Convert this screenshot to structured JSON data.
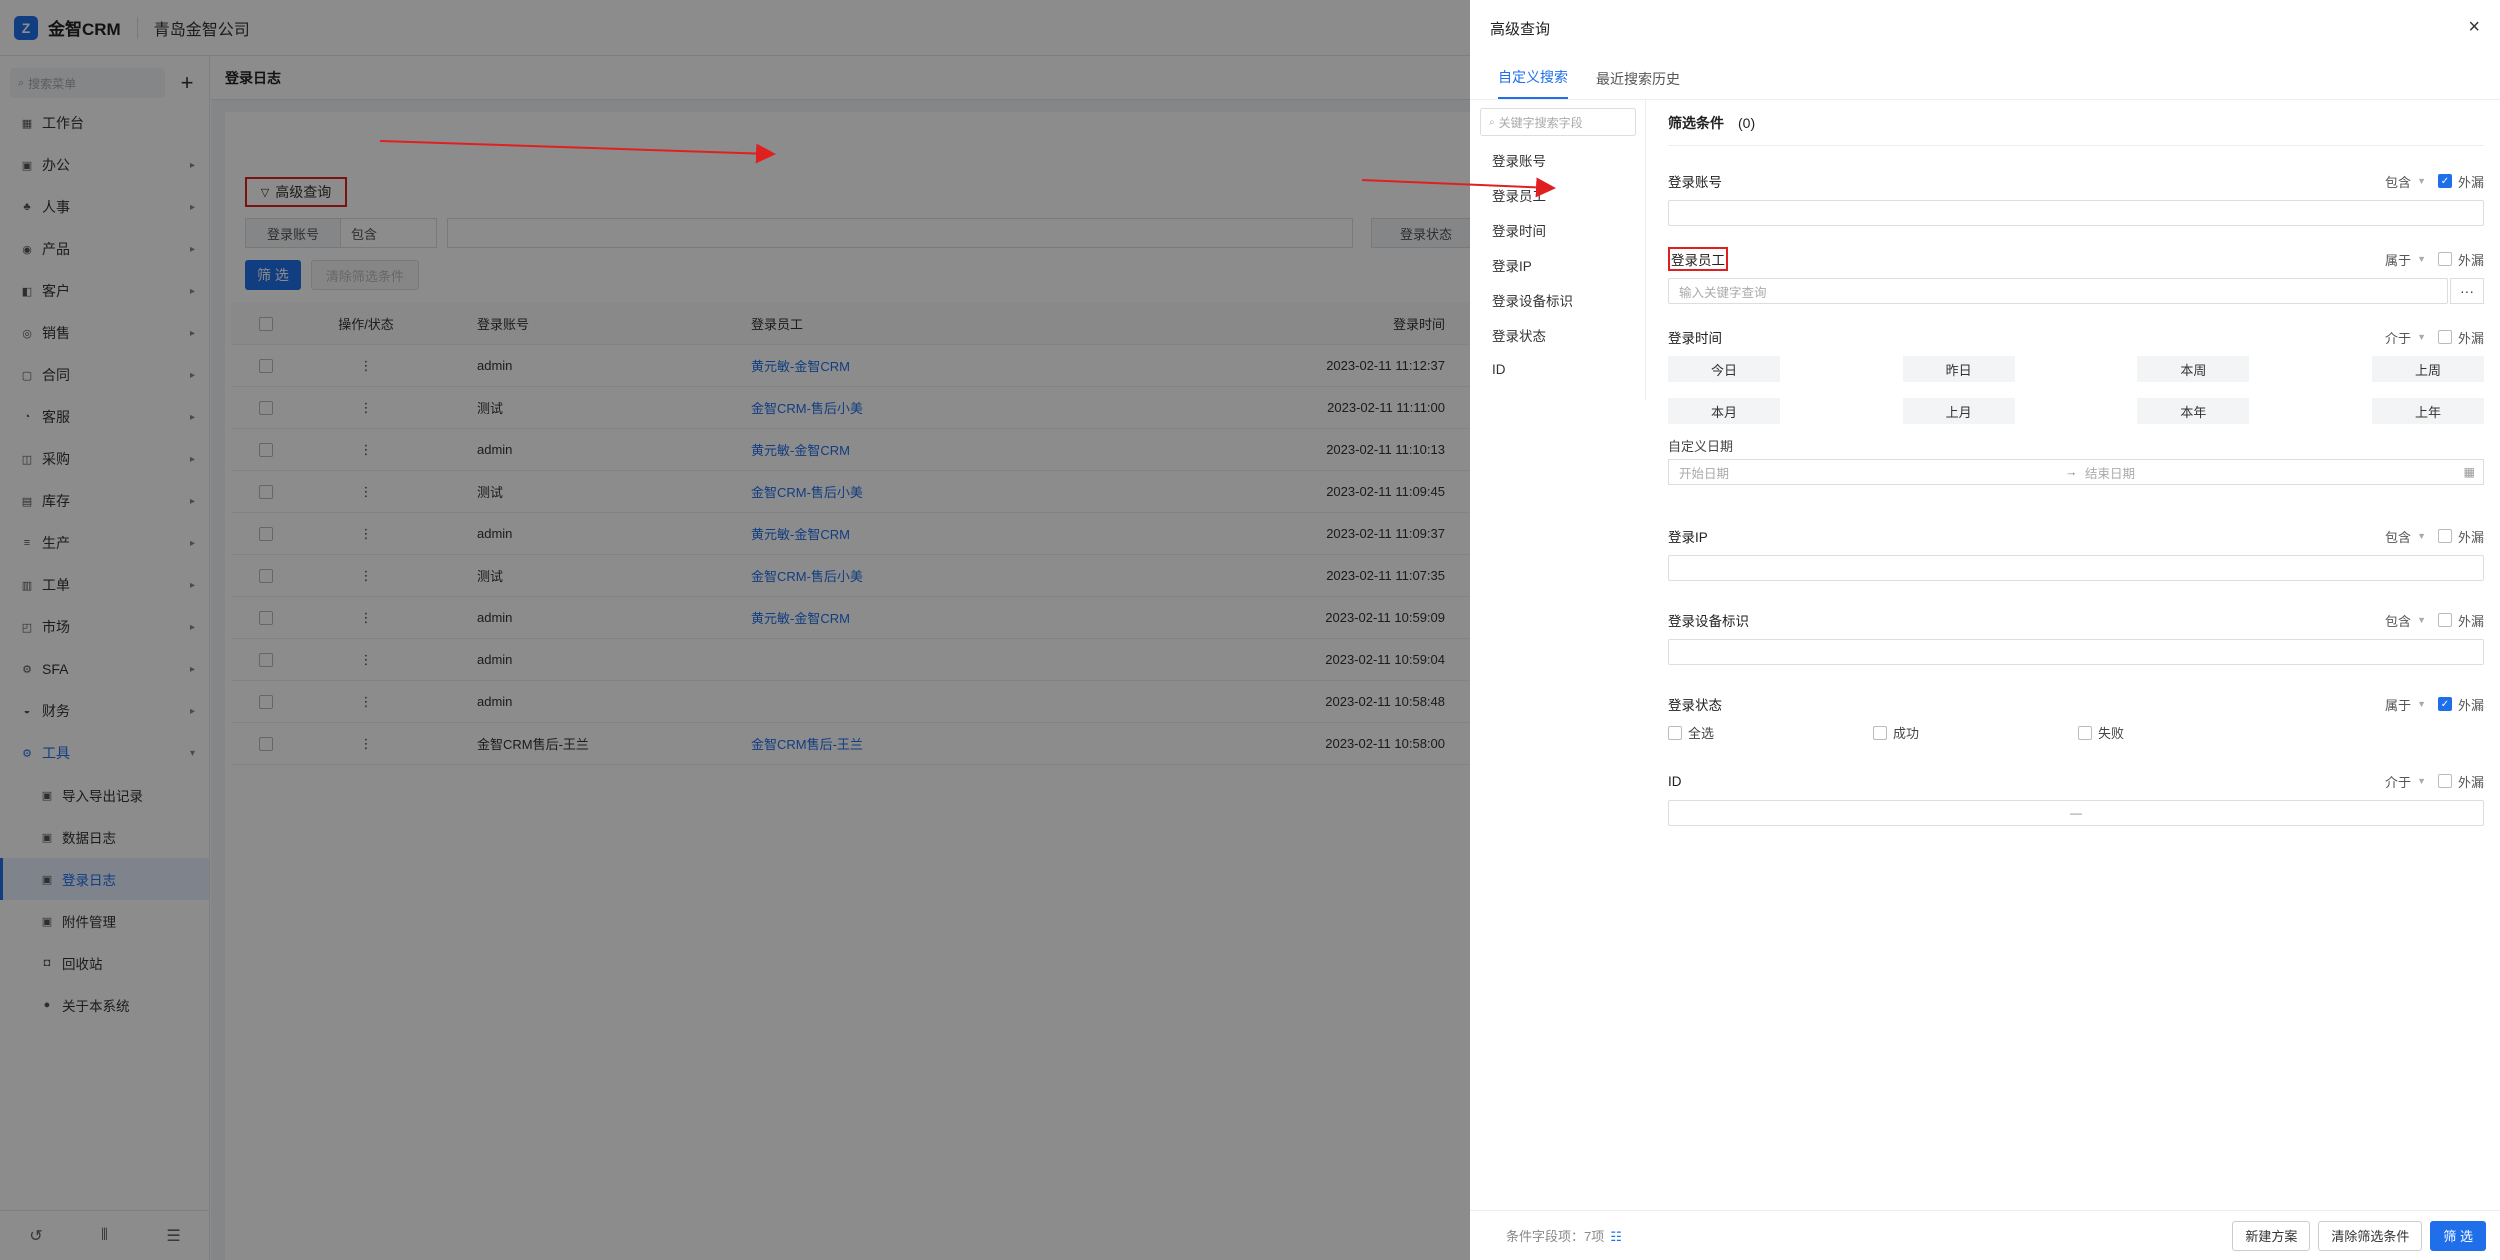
{
  "app": {
    "logo_mark": "Z",
    "name": "金智CRM",
    "company": "青岛金智公司"
  },
  "sidebar": {
    "search_placeholder": "搜索菜单",
    "add": "+",
    "items": [
      {
        "label": "工作台",
        "icon": "▦"
      },
      {
        "label": "办公",
        "icon": "▣"
      },
      {
        "label": "人事",
        "icon": "♣"
      },
      {
        "label": "产品",
        "icon": "◉"
      },
      {
        "label": "客户",
        "icon": "◧"
      },
      {
        "label": "销售",
        "icon": "◎"
      },
      {
        "label": "合同",
        "icon": "▢"
      },
      {
        "label": "客服",
        "icon": "◔"
      },
      {
        "label": "采购",
        "icon": "◫"
      },
      {
        "label": "库存",
        "icon": "▤"
      },
      {
        "label": "生产",
        "icon": "≡"
      },
      {
        "label": "工单",
        "icon": "▥"
      },
      {
        "label": "市场",
        "icon": "◰"
      },
      {
        "label": "SFA",
        "icon": "⚙"
      },
      {
        "label": "财务",
        "icon": "◒"
      },
      {
        "label": "工具",
        "icon": "⚙"
      }
    ],
    "sub_items": [
      {
        "label": "导入导出记录"
      },
      {
        "label": "数据日志"
      },
      {
        "label": "登录日志"
      },
      {
        "label": "附件管理"
      },
      {
        "label": "回收站"
      },
      {
        "label": "关于本系统"
      }
    ],
    "footer_icons": [
      "history-icon",
      "chart-icon",
      "menu-icon"
    ]
  },
  "main": {
    "page_title": "登录日志",
    "adv_button": "高级查询",
    "filter": {
      "field": "登录账号",
      "op": "包含",
      "field2": "登录状态"
    },
    "filter_btn": "筛 选",
    "clear_btn": "清除筛选条件",
    "columns": [
      "操作/状态",
      "登录账号",
      "登录员工",
      "登录时间"
    ],
    "rows": [
      {
        "op": "⋮",
        "account": "admin",
        "employee": "黄元敏-金智CRM",
        "time": "2023-02-11 11:12:37"
      },
      {
        "op": "⋮",
        "account": "测试",
        "employee": "金智CRM-售后小美",
        "time": "2023-02-11 11:11:00"
      },
      {
        "op": "⋮",
        "account": "admin",
        "employee": "黄元敏-金智CRM",
        "time": "2023-02-11 11:10:13"
      },
      {
        "op": "⋮",
        "account": "测试",
        "employee": "金智CRM-售后小美",
        "time": "2023-02-11 11:09:45"
      },
      {
        "op": "⋮",
        "account": "admin",
        "employee": "黄元敏-金智CRM",
        "time": "2023-02-11 11:09:37"
      },
      {
        "op": "⋮",
        "account": "测试",
        "employee": "金智CRM-售后小美",
        "time": "2023-02-11 11:07:35"
      },
      {
        "op": "⋮",
        "account": "admin",
        "employee": "黄元敏-金智CRM",
        "time": "2023-02-11 10:59:09"
      },
      {
        "op": "⋮",
        "account": "admin",
        "employee": "",
        "time": "2023-02-11 10:59:04"
      },
      {
        "op": "⋮",
        "account": "admin",
        "employee": "",
        "time": "2023-02-11 10:58:48"
      },
      {
        "op": "⋮",
        "account": "金智CRM售后-王兰",
        "employee": "金智CRM售后-王兰",
        "time": "2023-02-11 10:58:00"
      }
    ]
  },
  "drawer": {
    "title": "高级查询",
    "close": "×",
    "tabs": [
      "自定义搜索",
      "最近搜索历史"
    ],
    "field_search_placeholder": "关键字搜索字段",
    "field_list": [
      "登录账号",
      "登录员工",
      "登录时间",
      "登录IP",
      "登录设备标识",
      "登录状态",
      "ID"
    ],
    "conditions_label": "筛选条件",
    "conditions_count": "(0)",
    "ext_label": "外漏",
    "fields": {
      "account": {
        "label": "登录账号",
        "op": "包含"
      },
      "employee": {
        "label": "登录员工",
        "op": "属于",
        "placeholder": "输入关键字查询",
        "dots": "···"
      },
      "time": {
        "label": "登录时间",
        "op": "介于",
        "buttons": [
          "今日",
          "昨日",
          "本周",
          "上周",
          "本月",
          "上月",
          "本年",
          "上年"
        ],
        "custom_label": "自定义日期",
        "start_ph": "开始日期",
        "to": "→",
        "end_ph": "结束日期"
      },
      "ip": {
        "label": "登录IP",
        "op": "包含"
      },
      "device": {
        "label": "登录设备标识",
        "op": "包含"
      },
      "status": {
        "label": "登录状态",
        "op": "属于",
        "options": [
          "全选",
          "成功",
          "失败"
        ]
      },
      "id": {
        "label": "ID",
        "op": "介于",
        "sep": "—"
      }
    },
    "footer": {
      "count_text": "条件字段项：7项",
      "buttons": [
        "新建方案",
        "清除筛选条件",
        "筛 选"
      ]
    }
  },
  "colors": {
    "primary": "#1f6feb",
    "annotation": "#e02020"
  }
}
